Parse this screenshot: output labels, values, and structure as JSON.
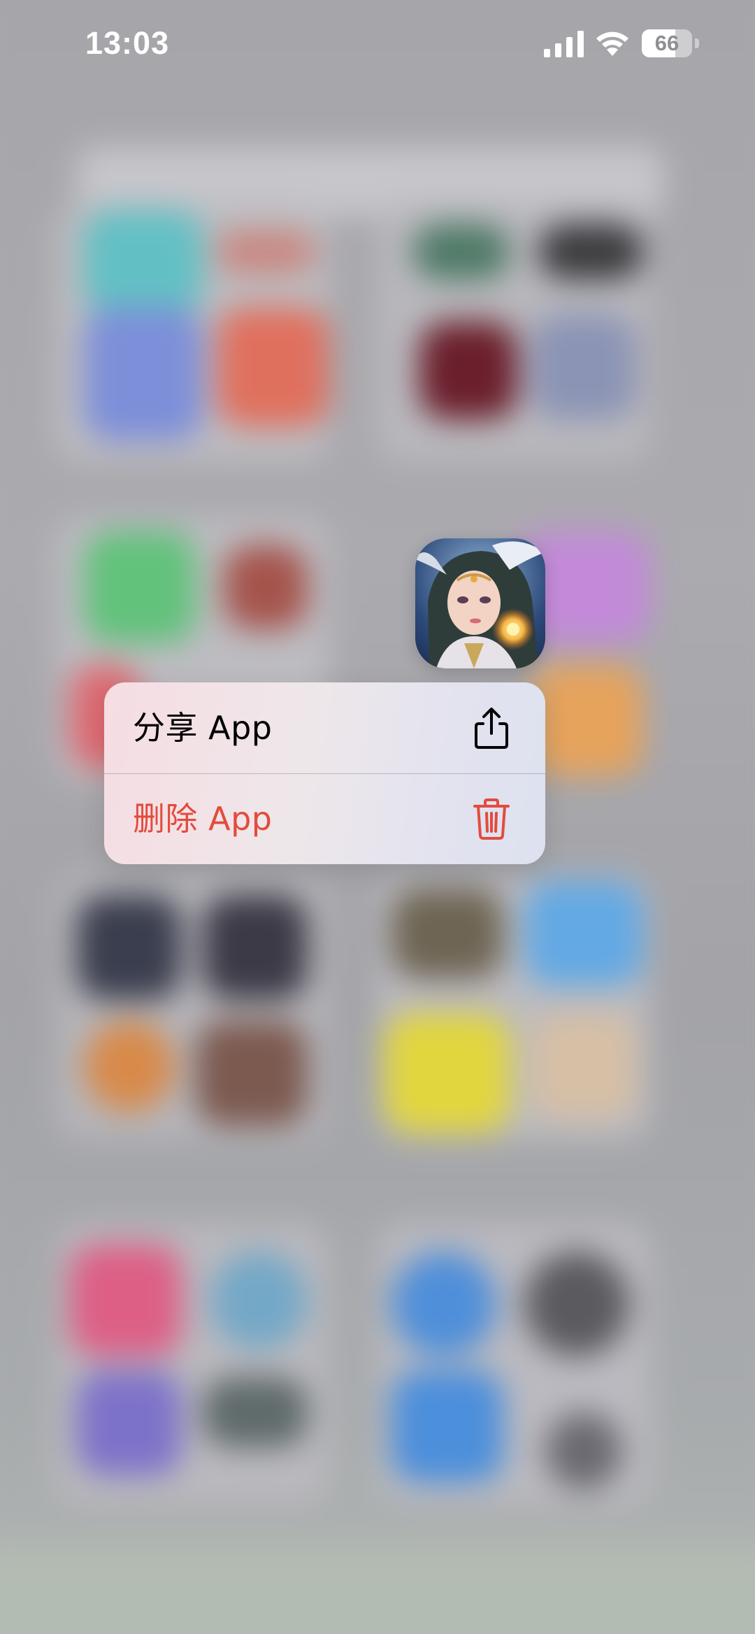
{
  "status_bar": {
    "time": "13:03",
    "battery_level": "66",
    "battery_percent": 66
  },
  "focused_app": {
    "icon": "game-hero-portrait-icon"
  },
  "context_menu": {
    "items": [
      {
        "label": "分享 App",
        "icon": "share-icon",
        "color": "#000000"
      },
      {
        "label": "删除 App",
        "icon": "trash-icon",
        "color": "#e34b3d"
      }
    ]
  },
  "colors": {
    "destructive": "#e34b3d",
    "menu_background": "#ebe6ec"
  }
}
